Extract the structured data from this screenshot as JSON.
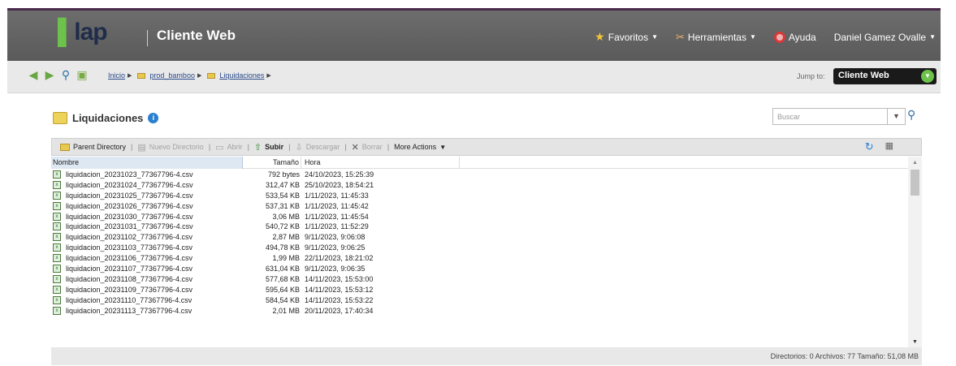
{
  "header": {
    "logo_text": "lap",
    "app_title": "Cliente Web",
    "nav": [
      {
        "label": "Favoritos",
        "icon": "star-icon"
      },
      {
        "label": "Herramientas",
        "icon": "tools-icon"
      },
      {
        "label": "Ayuda",
        "icon": "help-icon"
      },
      {
        "label": "Daniel Gamez Ovalle",
        "icon": ""
      }
    ]
  },
  "pathbar": {
    "breadcrumbs": [
      "Inicio",
      "prod_bamboo",
      "Liquidaciones"
    ],
    "jump_label": "Jump to:",
    "jump_value": "Cliente Web"
  },
  "panel": {
    "title": "Liquidaciones",
    "search_placeholder": "Buscar"
  },
  "toolbar": {
    "parent_directory": "Parent Directory",
    "new_directory": "Nuevo Directorio",
    "open": "Abrir",
    "upload": "Subir",
    "download": "Descargar",
    "delete": "Borrar",
    "more_actions": "More Actions"
  },
  "table": {
    "headers": {
      "name": "Nombre",
      "size": "Tamaño",
      "time": "Hora"
    },
    "rows": [
      {
        "name": "liquidacion_20231023_77367796-4.csv",
        "size": "792 bytes",
        "time": "24/10/2023, 15:25:39"
      },
      {
        "name": "liquidacion_20231024_77367796-4.csv",
        "size": "312,47 KB",
        "time": "25/10/2023, 18:54:21"
      },
      {
        "name": "liquidacion_20231025_77367796-4.csv",
        "size": "533,54 KB",
        "time": "1/11/2023, 11:45:33"
      },
      {
        "name": "liquidacion_20231026_77367796-4.csv",
        "size": "537,31 KB",
        "time": "1/11/2023, 11:45:42"
      },
      {
        "name": "liquidacion_20231030_77367796-4.csv",
        "size": "3,06 MB",
        "time": "1/11/2023, 11:45:54"
      },
      {
        "name": "liquidacion_20231031_77367796-4.csv",
        "size": "540,72 KB",
        "time": "1/11/2023, 11:52:29"
      },
      {
        "name": "liquidacion_20231102_77367796-4.csv",
        "size": "2,87 MB",
        "time": "9/11/2023, 9:06:08"
      },
      {
        "name": "liquidacion_20231103_77367796-4.csv",
        "size": "494,78 KB",
        "time": "9/11/2023, 9:06:25"
      },
      {
        "name": "liquidacion_20231106_77367796-4.csv",
        "size": "1,99 MB",
        "time": "22/11/2023, 18:21:02"
      },
      {
        "name": "liquidacion_20231107_77367796-4.csv",
        "size": "631,04 KB",
        "time": "9/11/2023, 9:06:35"
      },
      {
        "name": "liquidacion_20231108_77367796-4.csv",
        "size": "577,68 KB",
        "time": "14/11/2023, 15:53:00"
      },
      {
        "name": "liquidacion_20231109_77367796-4.csv",
        "size": "595,64 KB",
        "time": "14/11/2023, 15:53:12"
      },
      {
        "name": "liquidacion_20231110_77367796-4.csv",
        "size": "584,54 KB",
        "time": "14/11/2023, 15:53:22"
      },
      {
        "name": "liquidacion_20231113_77367796-4.csv",
        "size": "2,01 MB",
        "time": "20/11/2023, 17:40:34"
      }
    ]
  },
  "status": {
    "text": "Directorios: 0   Archivos: 77   Tamaño: 51,08 MB"
  },
  "colors": {
    "header_bg": "#5f5f5f",
    "brand_green": "#6cc24a",
    "link_blue": "#2a4a8a",
    "selected_header": "#dde8f3"
  }
}
